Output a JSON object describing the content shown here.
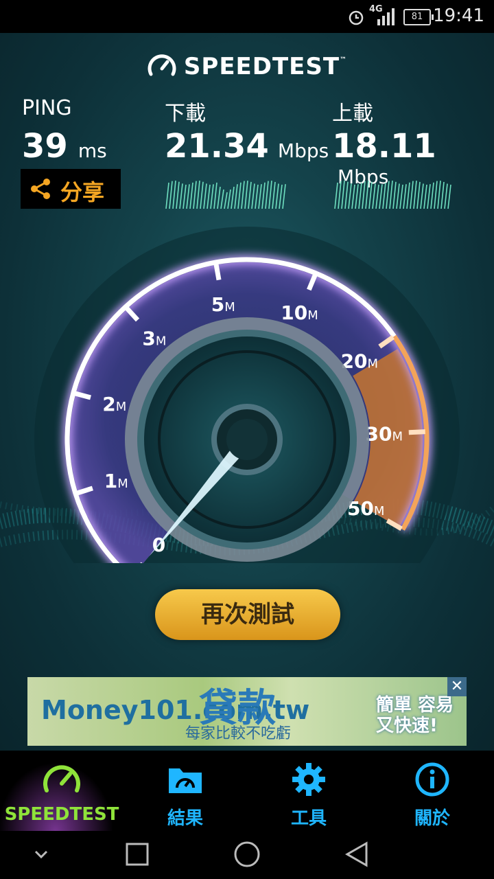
{
  "status_bar": {
    "network": "4G",
    "battery": "81",
    "time": "19:41"
  },
  "header": {
    "title": "SPEEDTEST",
    "trademark": "™"
  },
  "results": {
    "ping": {
      "label": "PING",
      "value": "39",
      "unit": "ms"
    },
    "download": {
      "label": "下載",
      "value": "21.34",
      "unit": "Mbps"
    },
    "upload": {
      "label": "上載",
      "value": "18.11",
      "unit": "Mbps"
    },
    "share_label": "分享"
  },
  "gauge": {
    "scale_labels": [
      {
        "num": "0",
        "unit": ""
      },
      {
        "num": "1",
        "unit": "M"
      },
      {
        "num": "2",
        "unit": "M"
      },
      {
        "num": "3",
        "unit": "M"
      },
      {
        "num": "5",
        "unit": "M"
      },
      {
        "num": "10",
        "unit": "M"
      },
      {
        "num": "20",
        "unit": "M"
      },
      {
        "num": "30",
        "unit": "M"
      },
      {
        "num": "50",
        "unit": "M"
      }
    ],
    "needle_value_mbps": 0,
    "upload_zone_from_mbps": 20
  },
  "retest_button": "再次測試",
  "ad": {
    "brand": "Money101.com.tw",
    "headline": "貸款",
    "subline": "每家比較不吃虧",
    "right_text": "簡單 容易 又快速!",
    "close": "✕"
  },
  "tabs": [
    {
      "label": "SPEEDTEST",
      "icon": "speedometer-icon",
      "active": true
    },
    {
      "label": "結果",
      "icon": "folder-results-icon",
      "active": false
    },
    {
      "label": "工具",
      "icon": "gear-icon",
      "active": false
    },
    {
      "label": "關於",
      "icon": "info-icon",
      "active": false
    }
  ],
  "colors": {
    "accent_green": "#8fe33a",
    "accent_blue": "#1fb6ff",
    "share_orange": "#f5a623",
    "gauge_purple": "#b07cf0",
    "upload_orange": "#e8862a"
  }
}
